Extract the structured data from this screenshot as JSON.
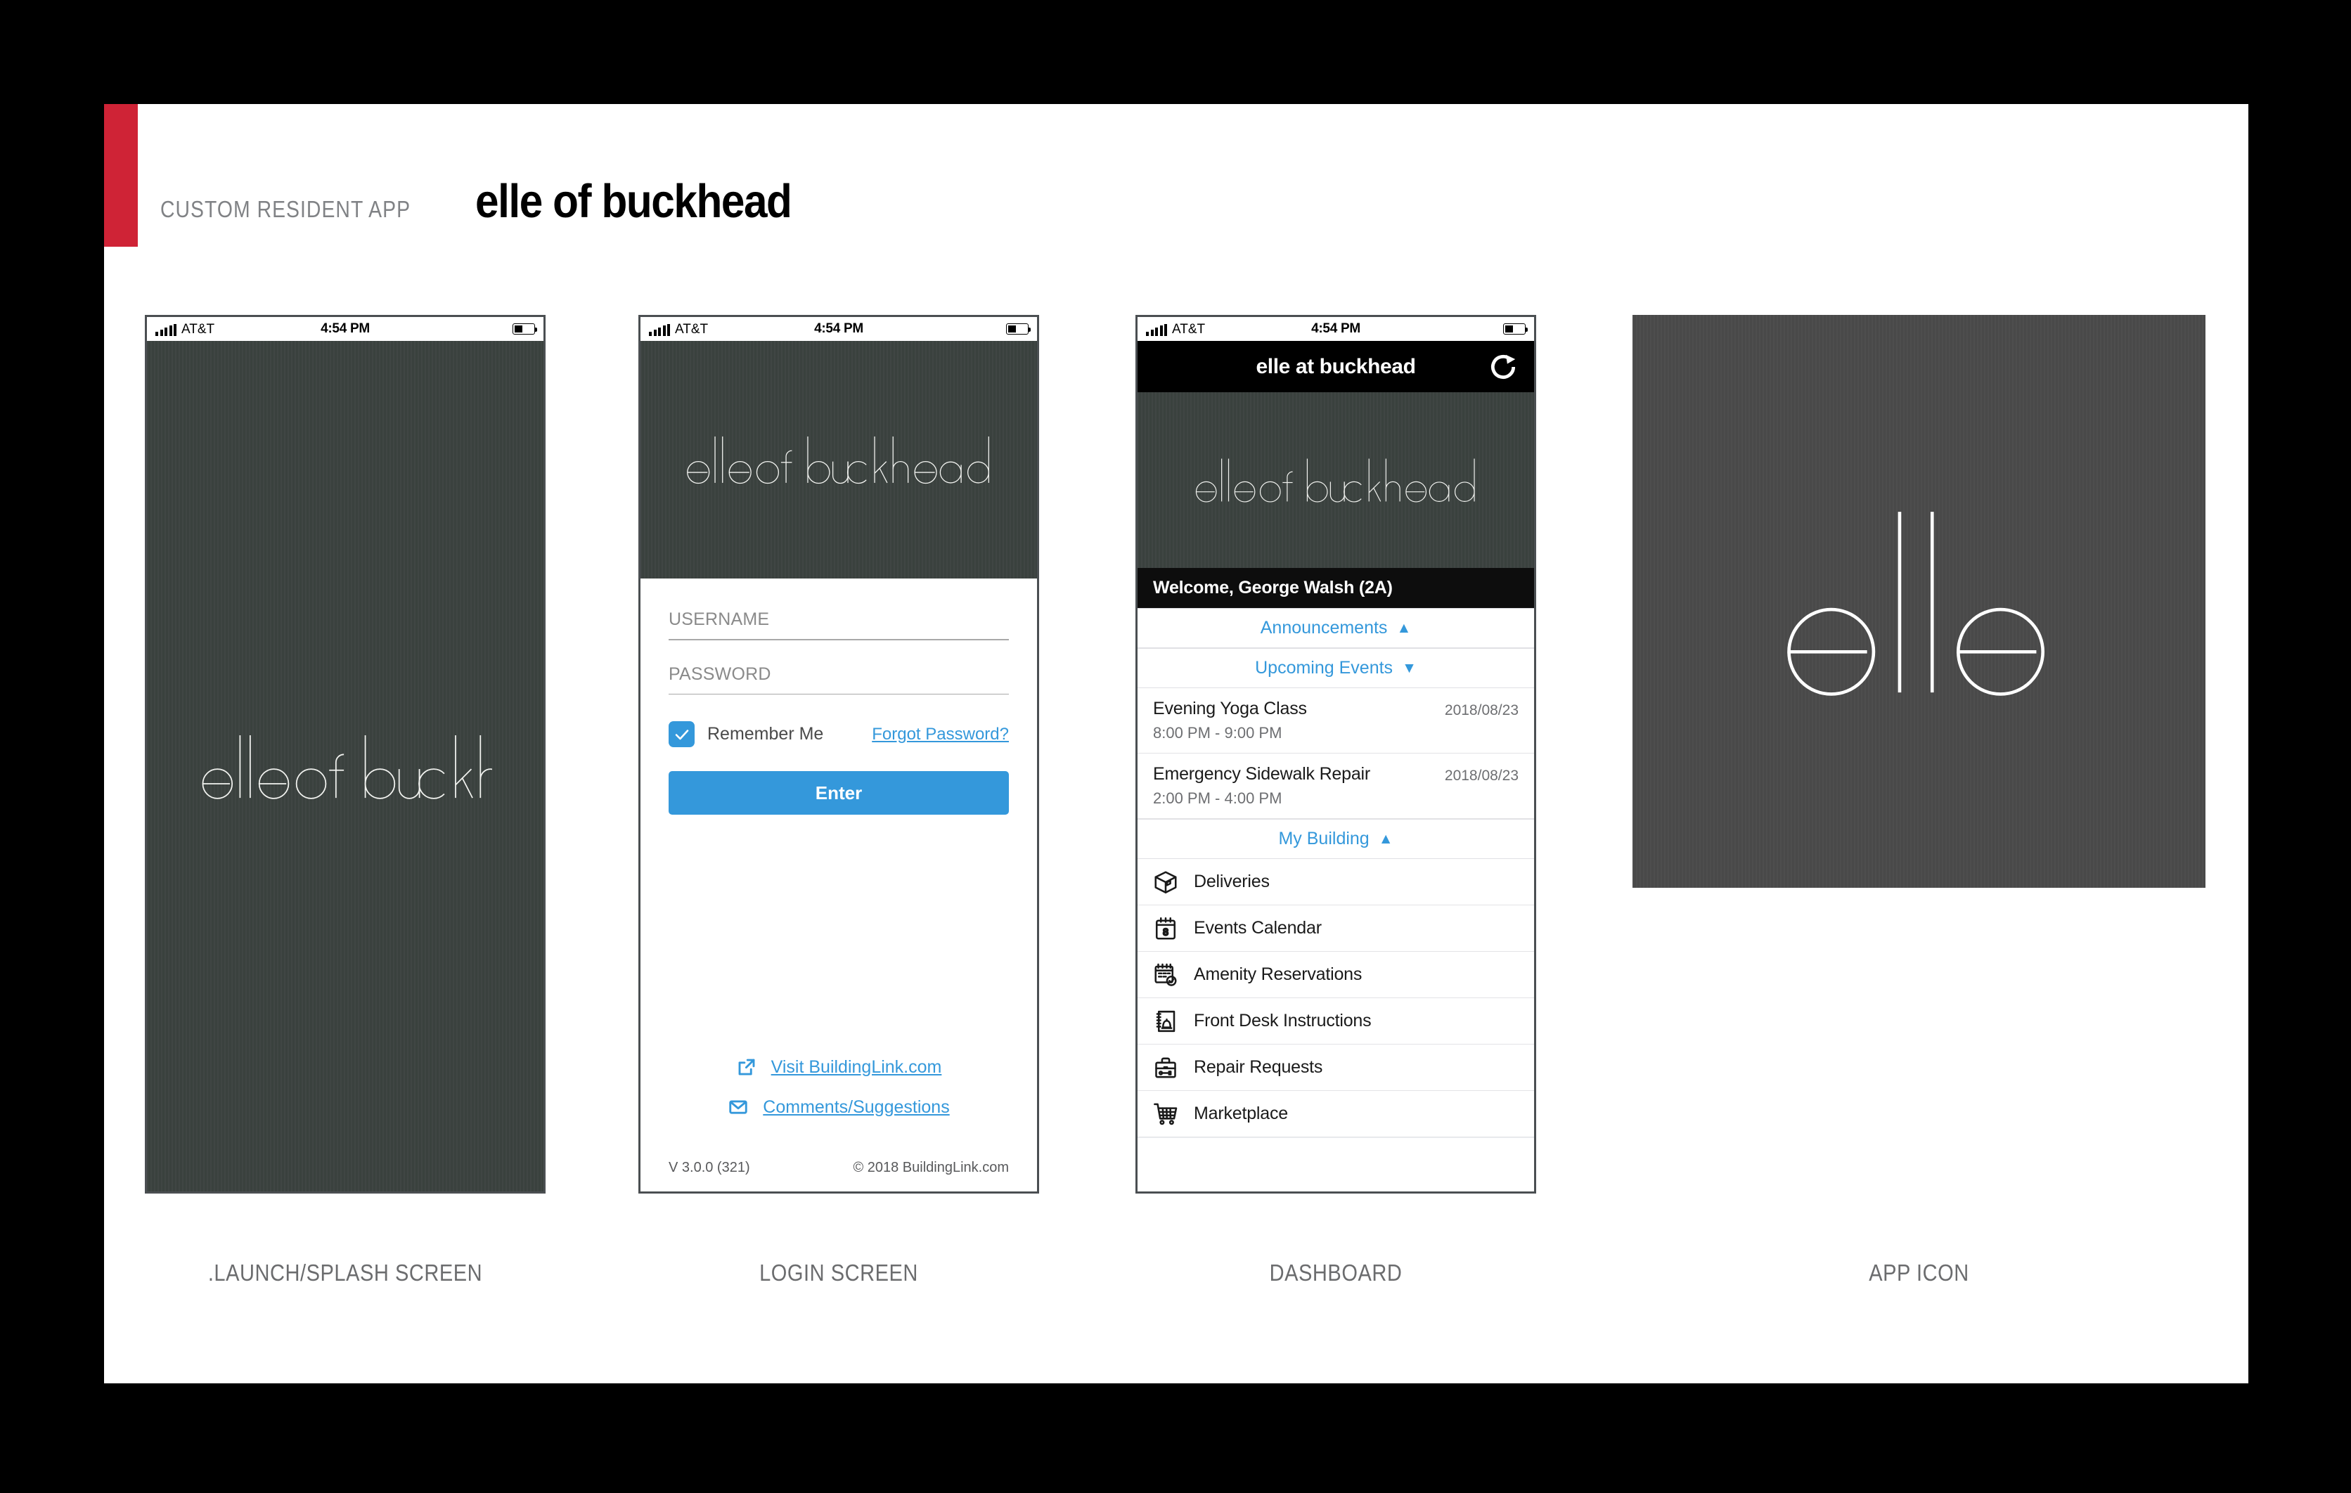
{
  "page": {
    "kicker": "CUSTOM RESIDENT APP",
    "title": "elle of buckhead",
    "accent_color": "#cf2336",
    "canvas_color": "#ffffff",
    "background_color": "#000000"
  },
  "status_bar": {
    "carrier": "AT&T",
    "time": "4:54 PM",
    "signal_icon": "signal-bars-icon",
    "battery_icon": "battery-icon"
  },
  "brand": {
    "wordmark": "elle of buckhead",
    "short_mark": "elle",
    "dark_bg": "#3b423f",
    "icon_bg": "#4a4a4a",
    "accent_blue": "#3498db"
  },
  "panels": [
    {
      "id": "splash",
      "caption": ".LAUNCH/SPLASH SCREEN"
    },
    {
      "id": "login",
      "caption": "LOGIN SCREEN"
    },
    {
      "id": "dashboard",
      "caption": "DASHBOARD"
    },
    {
      "id": "appicon",
      "caption": "APP ICON"
    }
  ],
  "splash": {
    "logo": "elle of buckhead"
  },
  "login": {
    "logo": "elle of buckhead",
    "username_label": "USERNAME",
    "username_value": "",
    "password_label": "PASSWORD",
    "password_value": "",
    "remember_label": "Remember Me",
    "remember_checked": true,
    "forgot_label": "Forgot Password?",
    "enter_label": "Enter",
    "links": [
      {
        "label": "Visit BuildingLink.com",
        "icon": "external-link-icon"
      },
      {
        "label": "Comments/Suggestions",
        "icon": "envelope-icon"
      }
    ],
    "version": "V 3.0.0 (321)",
    "copyright": "© 2018 BuildingLink.com"
  },
  "dashboard": {
    "nav_title": "elle at buckhead",
    "refresh_icon": "refresh-icon",
    "logo": "elle of buckhead",
    "welcome": "Welcome, George Walsh (2A)",
    "sections": [
      {
        "label": "Announcements",
        "caret": "▲",
        "expanded": true
      },
      {
        "label": "Upcoming Events",
        "caret": "▼",
        "expanded": false
      },
      {
        "label": "My Building",
        "caret": "▲",
        "expanded": true
      }
    ],
    "events": [
      {
        "title": "Evening Yoga Class",
        "time": "8:00 PM - 9:00 PM",
        "date": "2018/08/23"
      },
      {
        "title": "Emergency Sidewalk Repair",
        "time": "2:00 PM - 4:00 PM",
        "date": "2018/08/23"
      }
    ],
    "menu": [
      {
        "label": "Deliveries",
        "icon": "package-box-icon"
      },
      {
        "label": "Events Calendar",
        "icon": "calendar-icon"
      },
      {
        "label": "Amenity Reservations",
        "icon": "calendar-check-icon"
      },
      {
        "label": "Front Desk Instructions",
        "icon": "notepad-bell-icon"
      },
      {
        "label": "Repair Requests",
        "icon": "toolbox-icon"
      },
      {
        "label": "Marketplace",
        "icon": "shopping-cart-icon"
      }
    ]
  },
  "app_icon": {
    "mark": "elle"
  }
}
